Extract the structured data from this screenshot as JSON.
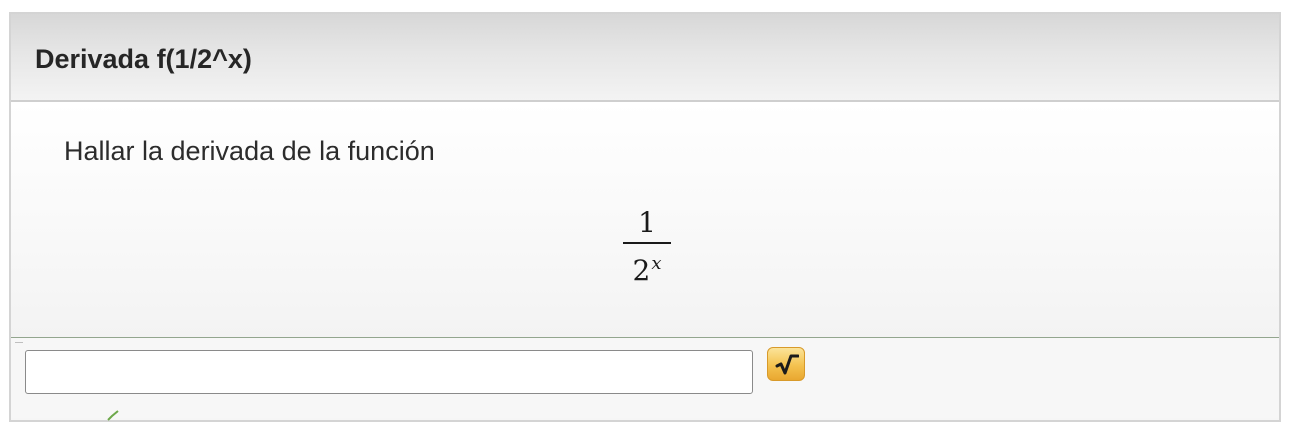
{
  "question": {
    "title": "Derivada f(1/2^x)",
    "instruction": "Hallar la derivada de la función",
    "formula": {
      "numerator": "1",
      "denominator_base": "2",
      "denominator_exponent": "x"
    }
  },
  "answer": {
    "value": "",
    "placeholder": ""
  },
  "toolbar": {
    "math_editor_icon": "square-root-icon"
  },
  "colors": {
    "header_gradient_top": "#d7d7d7",
    "body_background": "#f6f6f6",
    "divider": "#93a68e",
    "editor_button": "#f4c24f"
  }
}
